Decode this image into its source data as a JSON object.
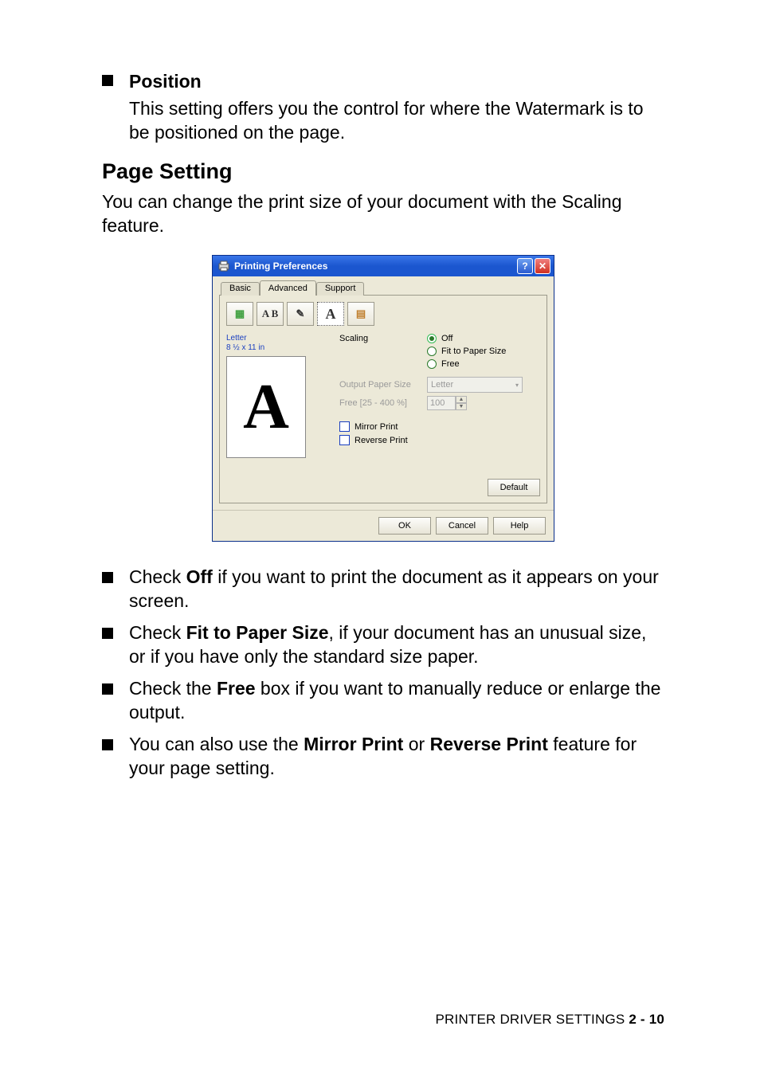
{
  "position_block": {
    "heading": "Position",
    "body": "This setting offers you the control for where the Watermark is to be positioned on the page."
  },
  "section_heading": "Page Setting",
  "lead_paragraph": "You can change the print size of your document with the Scaling feature.",
  "dialog": {
    "title": "Printing Preferences",
    "help_glyph": "?",
    "close_glyph": "✕",
    "tabs": {
      "basic": "Basic",
      "advanced": "Advanced",
      "support": "Support"
    },
    "toolbar": {
      "btn1": "▦",
      "btn2": "A B",
      "btn3": "✎",
      "btn4": "A",
      "btn5": "▤"
    },
    "preview": {
      "line1": "Letter",
      "line2": "8 ½ x 11 in",
      "glyph": "A"
    },
    "scaling_label": "Scaling",
    "radios": {
      "off": "Off",
      "fit": "Fit to Paper Size",
      "free": "Free"
    },
    "output_label": "Output Paper Size",
    "output_value": "Letter",
    "free_label": "Free [25 - 400 %]",
    "free_value": "100",
    "mirror": "Mirror Print",
    "reverse": "Reverse Print",
    "default_btn": "Default",
    "ok": "OK",
    "cancel": "Cancel",
    "help": "Help"
  },
  "bullets": {
    "b1a": "Check ",
    "b1b": "Off",
    "b1c": " if you want to print the document as it appears on your screen.",
    "b2a": "Check ",
    "b2b": "Fit to Paper Size",
    "b2c": ", if your document has an unusual size, or if you have only the standard size paper.",
    "b3a": "Check the ",
    "b3b": "Free",
    "b3c": " box if you want to manually reduce or enlarge the output.",
    "b4a": "You can also use the ",
    "b4b": "Mirror Print",
    "b4c": " or ",
    "b4d": "Reverse Print",
    "b4e": " feature for your page setting."
  },
  "footer": {
    "label": "PRINTER DRIVER SETTINGS   ",
    "page": "2 - 10"
  }
}
